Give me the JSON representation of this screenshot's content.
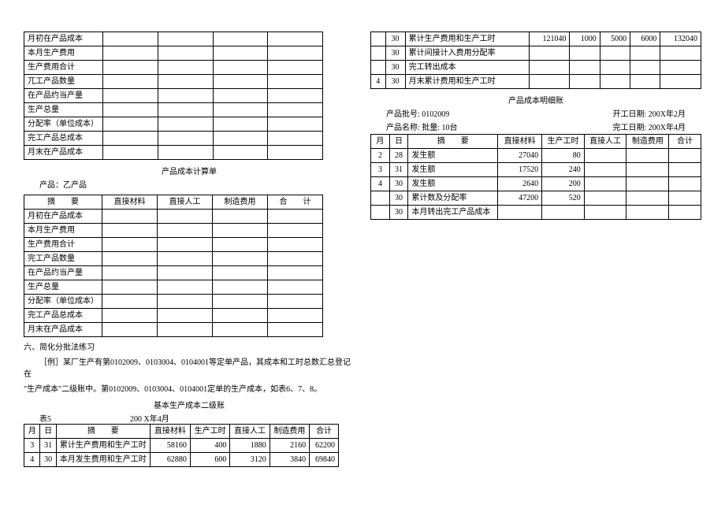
{
  "left": {
    "small_table_rows": [
      "月初在产品成本",
      "本月生产费用",
      "生产费用合计",
      "兀工产品数量",
      "在产品约当产量",
      "生产总量",
      "分配率（单位成本）",
      "完工产品总成本",
      "月末在产品成本"
    ],
    "calc_title": "产品成本计算单",
    "product_label": "产品：乙产品",
    "calc_headers": [
      "摘　　要",
      "直接材料",
      "直接人工",
      "制造费用",
      "合　　计"
    ],
    "calc_rows": [
      "月初在产品成本",
      "本月生产费用",
      "生产费用合计",
      "完工产品数量",
      "在产品约当产量",
      "生产总量",
      "分配率（单位成本）",
      "完工产品总成本",
      "月末在产品成本"
    ],
    "section6": "六、简化分批法练习",
    "example1": "［例］某厂生产有第0102009、0103004、0104001等定单产品，其成本和工时总数汇总登记 在",
    "example2": "\"生产成本\"二级账中。第0102009、0103004、0104001定单的生产成本，如表6、7、8。",
    "ledger_title": "基本生产成本二级账",
    "table5_label": "表5",
    "table5_period": "200 X年4月",
    "ledger_headers": [
      "月",
      "日",
      "摘　　要",
      "直接材料",
      "生产工时",
      "直接人工",
      "制造费用",
      "合计"
    ],
    "ledger_rows": [
      {
        "m": "3",
        "d": "31",
        "desc": "累计生产费用和生产工时",
        "mat": "58160",
        "hrs": "400",
        "lab": "1880",
        "mfg": "2160",
        "tot": "62200"
      },
      {
        "m": "4",
        "d": "30",
        "desc": "本月发生费用和生产工时",
        "mat": "62880",
        "hrs": "600",
        "lab": "3120",
        "mfg": "3840",
        "tot": "69840"
      }
    ]
  },
  "right": {
    "top_rows": [
      {
        "m": "",
        "d": "30",
        "desc": "累计生产费用和生产工时",
        "mat": "121040",
        "hrs": "1000",
        "lab": "5000",
        "mfg": "6000",
        "tot": "132040"
      },
      {
        "m": "",
        "d": "30",
        "desc": "累计间接计入费用分配率",
        "mat": "",
        "hrs": "",
        "lab": "",
        "mfg": "",
        "tot": ""
      },
      {
        "m": "",
        "d": "30",
        "desc": "完工转出成本",
        "mat": "",
        "hrs": "",
        "lab": "",
        "mfg": "",
        "tot": ""
      },
      {
        "m": "4",
        "d": "30",
        "desc": "月末累计费用和生产工时",
        "mat": "",
        "hrs": "",
        "lab": "",
        "mfg": "",
        "tot": ""
      }
    ],
    "detail_title": "产品成本明细账",
    "batch_label": "产品批号: 0102009",
    "start_label": "开工日期: 200X年2月",
    "name_label": "产品名称: 批量: 10台",
    "end_label": "完工日期: 200X年4月",
    "detail_headers": [
      "月",
      "日",
      "摘　　要",
      "直接材料",
      "生产工时",
      "直接人工",
      "制造费用",
      "合计"
    ],
    "detail_rows": [
      {
        "m": "2",
        "d": "28",
        "desc": "发生额",
        "mat": "27040",
        "hrs": "80",
        "lab": "",
        "mfg": "",
        "tot": ""
      },
      {
        "m": "3",
        "d": "31",
        "desc": "发生额",
        "mat": "17520",
        "hrs": "240",
        "lab": "",
        "mfg": "",
        "tot": ""
      },
      {
        "m": "4",
        "d": "30",
        "desc": "发生额",
        "mat": "2640",
        "hrs": "200",
        "lab": "",
        "mfg": "",
        "tot": ""
      },
      {
        "m": "",
        "d": "30",
        "desc": "累计数及分配率",
        "mat": "47200",
        "hrs": "520",
        "lab": "",
        "mfg": "",
        "tot": ""
      },
      {
        "m": "",
        "d": "30",
        "desc": "本月转出完工产品成本",
        "mat": "",
        "hrs": "",
        "lab": "",
        "mfg": "",
        "tot": ""
      }
    ]
  },
  "chart_data": {
    "type": "table",
    "title": "基本生产成本二级账 & 产品成本明细账",
    "tables": [
      {
        "name": "基本生产成本二级账 200X年4月",
        "columns": [
          "月",
          "日",
          "摘要",
          "直接材料",
          "生产工时",
          "直接人工",
          "制造费用",
          "合计"
        ],
        "rows": [
          [
            "3",
            "31",
            "累计生产费用和生产工时",
            58160,
            400,
            1880,
            2160,
            62200
          ],
          [
            "4",
            "30",
            "本月发生费用和生产工时",
            62880,
            600,
            3120,
            3840,
            69840
          ],
          [
            "",
            "30",
            "累计生产费用和生产工时",
            121040,
            1000,
            5000,
            6000,
            132040
          ],
          [
            "",
            "30",
            "累计间接计入费用分配率",
            null,
            null,
            null,
            null,
            null
          ],
          [
            "",
            "30",
            "完工转出成本",
            null,
            null,
            null,
            null,
            null
          ],
          [
            "4",
            "30",
            "月末累计费用和生产工时",
            null,
            null,
            null,
            null,
            null
          ]
        ]
      },
      {
        "name": "产品成本明细账 0102009",
        "columns": [
          "月",
          "日",
          "摘要",
          "直接材料",
          "生产工时",
          "直接人工",
          "制造费用",
          "合计"
        ],
        "rows": [
          [
            "2",
            "28",
            "发生额",
            27040,
            80,
            null,
            null,
            null
          ],
          [
            "3",
            "31",
            "发生额",
            17520,
            240,
            null,
            null,
            null
          ],
          [
            "4",
            "30",
            "发生额",
            2640,
            200,
            null,
            null,
            null
          ],
          [
            "",
            "30",
            "累计数及分配率",
            47200,
            520,
            null,
            null,
            null
          ],
          [
            "",
            "30",
            "本月转出完工产品成本",
            null,
            null,
            null,
            null,
            null
          ]
        ]
      }
    ]
  }
}
